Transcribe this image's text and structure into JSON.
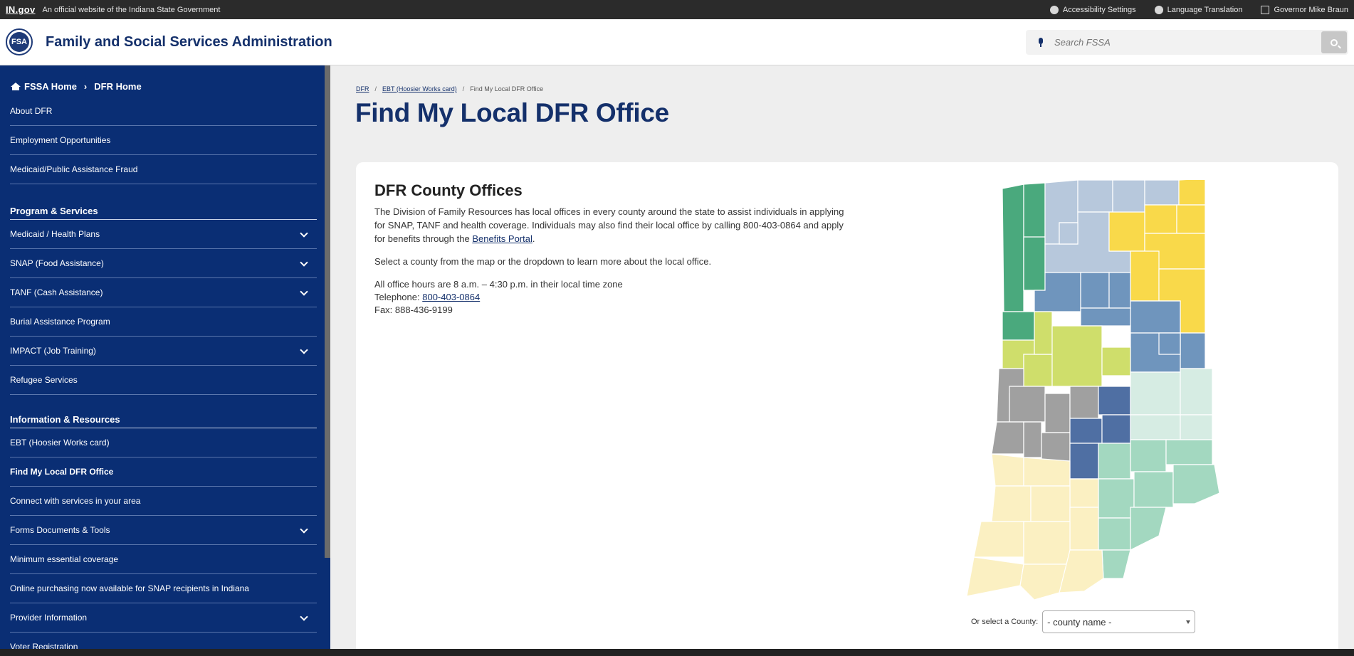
{
  "topbar": {
    "logo": "IN.gov",
    "official_text": "An official website of the Indiana State Government",
    "links": [
      {
        "label": "Accessibility Settings",
        "icon": "accessibility-icon"
      },
      {
        "label": "Language Translation",
        "icon": "globe-icon"
      },
      {
        "label": "Governor Mike Braun",
        "icon": "external-link-icon"
      }
    ]
  },
  "header": {
    "seal_text": "FSA",
    "title": "Family and Social Services Administration",
    "search_placeholder": "Search FSSA"
  },
  "sidebar": {
    "breadcrumb": {
      "home": "FSSA Home",
      "current": "DFR Home"
    },
    "group1": [
      {
        "label": "About DFR"
      },
      {
        "label": "Employment Opportunities"
      },
      {
        "label": "Medicaid/Public Assistance Fraud"
      }
    ],
    "heading_programs": "Program & Services",
    "programs": [
      {
        "label": "Medicaid / Health Plans",
        "expandable": true
      },
      {
        "label": "SNAP (Food Assistance)",
        "expandable": true
      },
      {
        "label": "TANF (Cash Assistance)",
        "expandable": true
      },
      {
        "label": "Burial Assistance Program",
        "expandable": false
      },
      {
        "label": "IMPACT (Job Training)",
        "expandable": true
      },
      {
        "label": "Refugee Services",
        "expandable": false
      }
    ],
    "heading_info": "Information & Resources",
    "info": [
      {
        "label": "EBT (Hoosier Works card)",
        "expandable": false
      },
      {
        "label": "Find My Local DFR Office",
        "expandable": false,
        "active": true
      },
      {
        "label": "Connect with services in your area",
        "expandable": false
      },
      {
        "label": "Forms Documents & Tools",
        "expandable": true
      },
      {
        "label": "Minimum essential coverage",
        "expandable": false
      },
      {
        "label": "Online purchasing now available for SNAP recipients in Indiana",
        "expandable": false
      },
      {
        "label": "Provider Information",
        "expandable": true
      },
      {
        "label": "Voter Registration",
        "expandable": false
      }
    ]
  },
  "main": {
    "breadcrumbs": [
      "DFR",
      "EBT (Hoosier Works card)",
      "Find My Local DFR Office"
    ],
    "title": "Find My Local DFR Office",
    "card": {
      "heading": "DFR County Offices",
      "intro_part1": "The Division of Family Resources has local offices in every county around the state to assist individuals in applying for SNAP, TANF and health coverage. Individuals may also find their local office by calling 800-403-0864 and apply for benefits through the ",
      "intro_link": "Benefits Portal",
      "intro_end": ".",
      "select_note": "Select a county from the map or the dropdown to learn more about the local office.",
      "hours": "All office hours are 8 a.m. – 4:30 p.m. in their local time zone",
      "telephone_label": "Telephone: ",
      "telephone": "800-403-0864",
      "fax": "Fax: 888-436-9199",
      "select_label": "Or select a County:",
      "select_value": "- county name -"
    },
    "map_colors": {
      "green": "#4aa97d",
      "lightblue": "#b7c8dc",
      "yellow": "#f9d94a",
      "steelblue": "#6f95bd",
      "lime": "#cfde6b",
      "gray": "#a0a0a0",
      "navy": "#4f6fa3",
      "mint": "#d6ece3",
      "seafoam": "#a3d8c0",
      "cream": "#fbf0c2"
    }
  }
}
